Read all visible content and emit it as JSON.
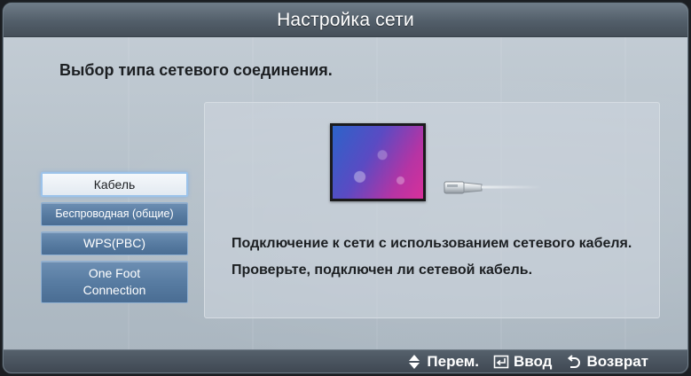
{
  "title": "Настройка сети",
  "subtitle": "Выбор типа сетевого соединения.",
  "menu": {
    "items": [
      {
        "label": "Кабель",
        "selected": true
      },
      {
        "label": "Беспроводная (общие)",
        "selected": false
      },
      {
        "label": "WPS(PBC)",
        "selected": false
      },
      {
        "label": "One Foot Connection",
        "selected": false
      }
    ]
  },
  "panel": {
    "image": "tv-screen-with-network-cable",
    "description": "Подключение к сети с использованием сетевого кабеля. Проверьте, подключен ли сетевой кабель."
  },
  "footer": {
    "hints": [
      {
        "icon": "up-down-arrows-icon",
        "label": "Перем."
      },
      {
        "icon": "enter-icon",
        "label": "Ввод"
      },
      {
        "icon": "return-icon",
        "label": "Возврат"
      }
    ]
  },
  "colors": {
    "title_bar": "#525e69",
    "button_blue": "#587ca2",
    "selected_button": "#e3eaf1",
    "background": "#b7c2cb"
  }
}
